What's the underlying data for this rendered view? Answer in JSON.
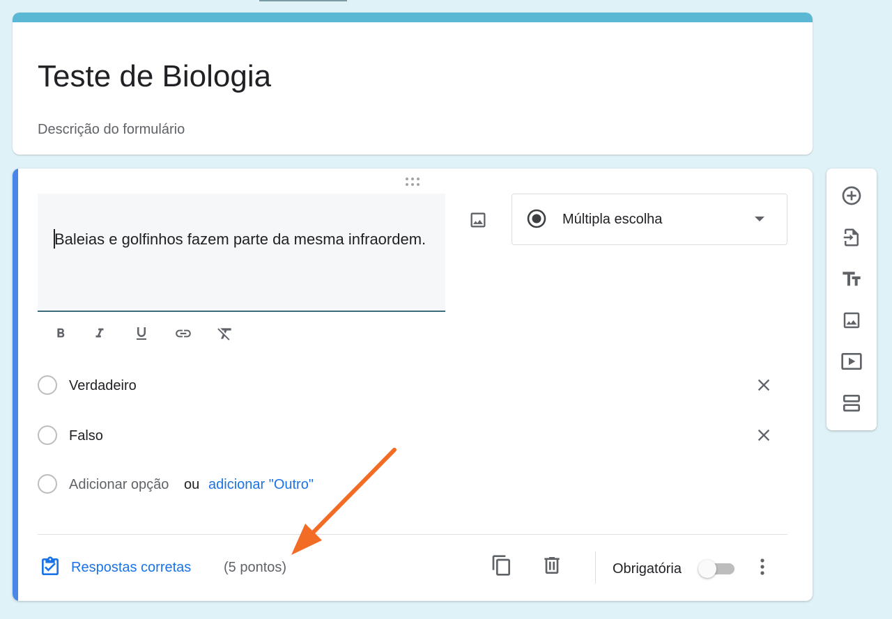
{
  "form": {
    "title": "Teste de Biologia",
    "description": "Descrição do formulário",
    "accent_color": "#5bb8d4"
  },
  "question": {
    "text": "Baleias e golfinhos fazem parte da mesma infraordem.",
    "type_label": "Múltipla escolha",
    "options": [
      {
        "label": "Verdadeiro"
      },
      {
        "label": "Falso"
      }
    ],
    "add_option": "Adicionar opção",
    "or_text": "ou",
    "add_other": "adicionar \"Outro\"",
    "answer_key_label": "Respostas corretas",
    "points": "(5 pontos)",
    "required_label": "Obrigatória",
    "required": false
  },
  "format_toolbar": [
    "bold-icon",
    "italic-icon",
    "underline-icon",
    "link-icon",
    "clear-format-icon"
  ],
  "side_toolbar": [
    "add-question-icon",
    "import-questions-icon",
    "add-title-icon",
    "add-image-icon",
    "add-video-icon",
    "add-section-icon"
  ]
}
